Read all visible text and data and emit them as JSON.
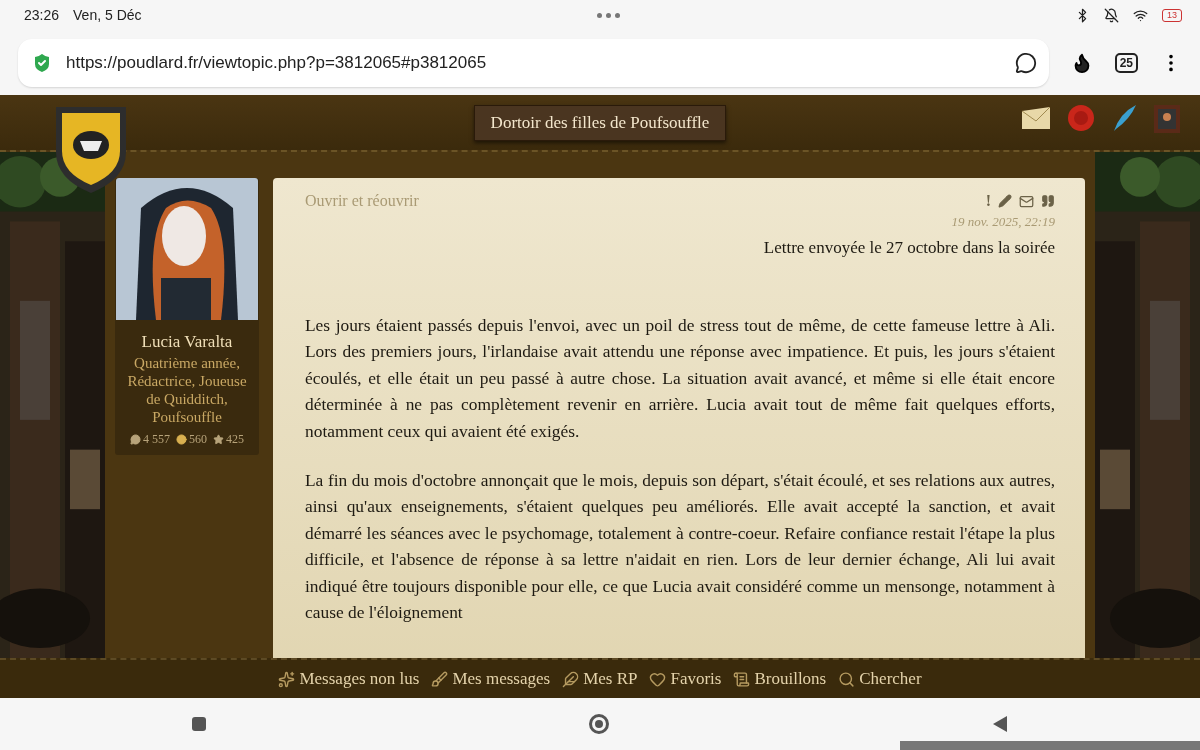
{
  "status_bar": {
    "time": "23:26",
    "date": "Ven, 5 Déc",
    "battery": "13"
  },
  "browser": {
    "url": "https://poudlard.fr/viewtopic.php?p=3812065#p3812065",
    "tab_count": "25"
  },
  "header": {
    "title": "Dortoir des filles de Poufsouffle"
  },
  "author": {
    "name": "Lucia Varalta",
    "rank": "Quatrième année, Rédactrice, Joueuse de Quidditch, Poufsouffle",
    "stats": [
      {
        "kind": "posts",
        "value": "4 557"
      },
      {
        "kind": "coins",
        "value": "560"
      },
      {
        "kind": "points",
        "value": "425"
      }
    ]
  },
  "post": {
    "title": "Ouvrir et réouvrir",
    "date": "19 nov. 2025, 22:19",
    "actions": [
      "!"
    ],
    "heading": "Lettre envoyée le 27 octobre dans la soirée",
    "paragraphs": [
      "Les jours étaient passés depuis l'envoi, avec un poil de stress tout de même, de cette fameuse lettre à Ali. Lors des premiers jours, l'irlandaise avait attendu une réponse avec impatience. Et puis, les jours s'étaient écoulés, et elle était un peu passé à autre chose. La situation avait avancé, et même si elle était encore déterminée à ne pas complètement revenir en arrière. Lucia avait tout de même fait quelques efforts, notamment ceux qui avaient été exigés.",
      "La fin du mois d'octobre annonçait que le mois, depuis son départ, s'était écoulé, et ses relations aux autres, ainsi qu'aux enseignements, s'étaient quelques peu améliorés. Elle avait accepté la sanction, et avait démarré les séances avec le psychomage, totalement à contre-coeur. Refaire confiance restait l'étape la plus difficile, et l'absence de réponse à sa lettre n'aidait en rien. Lors de leur dernier échange, Ali lui avait indiqué être toujours disponible pour elle, ce que Lucia avait considéré comme un mensonge, notamment à cause de l'éloignement"
    ]
  },
  "bottom_menu": [
    {
      "kind": "unread",
      "label": "Messages non lus"
    },
    {
      "kind": "mine",
      "label": "Mes messages"
    },
    {
      "kind": "rp",
      "label": "Mes RP"
    },
    {
      "kind": "fav",
      "label": "Favoris"
    },
    {
      "kind": "drafts",
      "label": "Brouillons"
    },
    {
      "kind": "search",
      "label": "Chercher"
    }
  ]
}
